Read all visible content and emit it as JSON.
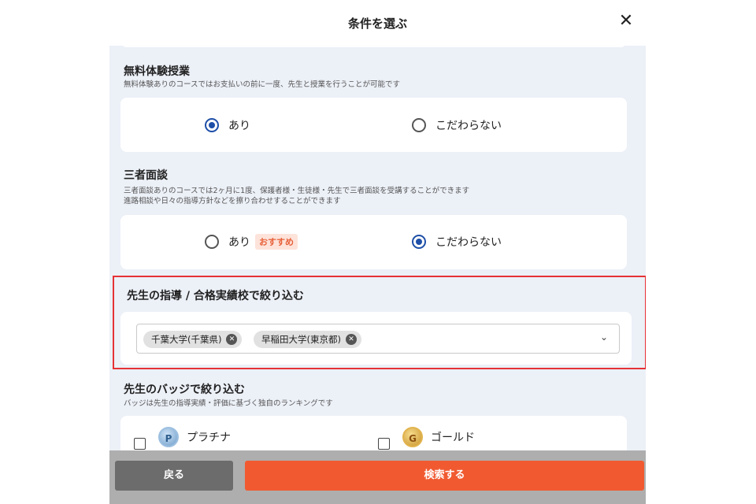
{
  "header": {
    "title": "条件を選ぶ",
    "close_icon": "close-icon"
  },
  "trial_lesson": {
    "title": "無料体験授業",
    "description": "無料体験ありのコースではお支払いの前に一度、先生と授業を行うことが可能です",
    "options": [
      {
        "label": "あり",
        "selected": true
      },
      {
        "label": "こだわらない",
        "selected": false
      }
    ]
  },
  "three_party": {
    "title": "三者面談",
    "description_lines": [
      "三者面談ありのコースでは2ヶ月に1度、保護者様・生徒様・先生で三者面談を受講することができます",
      "進路相談や日々の指導方針などを擦り合わせすることができます"
    ],
    "options": [
      {
        "label": "あり",
        "badge": "おすすめ",
        "selected": false
      },
      {
        "label": "こだわらない",
        "selected": true
      }
    ]
  },
  "school_filter": {
    "title": "先生の指導 / 合格実績校で絞り込む",
    "chips": [
      "千葉大学(千葉県)",
      "早稲田大学(東京都)"
    ],
    "chip_remove_icon": "remove-chip-icon",
    "dropdown_icon": "chevron-down-icon"
  },
  "badge_filter": {
    "title": "先生のバッジで絞り込む",
    "description": "バッジは先生の指導実績・評価に基づく独自のランキングです",
    "options": [
      {
        "label": "プラチナ",
        "icon_letter": "P",
        "checked": false
      },
      {
        "label": "ゴールド",
        "icon_letter": "G",
        "checked": false
      }
    ]
  },
  "footer": {
    "back_label": "戻る",
    "search_label": "検索する"
  },
  "colors": {
    "accent": "#f15a31",
    "radio_selected": "#1e4fa8",
    "highlight_border": "#e63236",
    "background": "#ecf0f7"
  }
}
